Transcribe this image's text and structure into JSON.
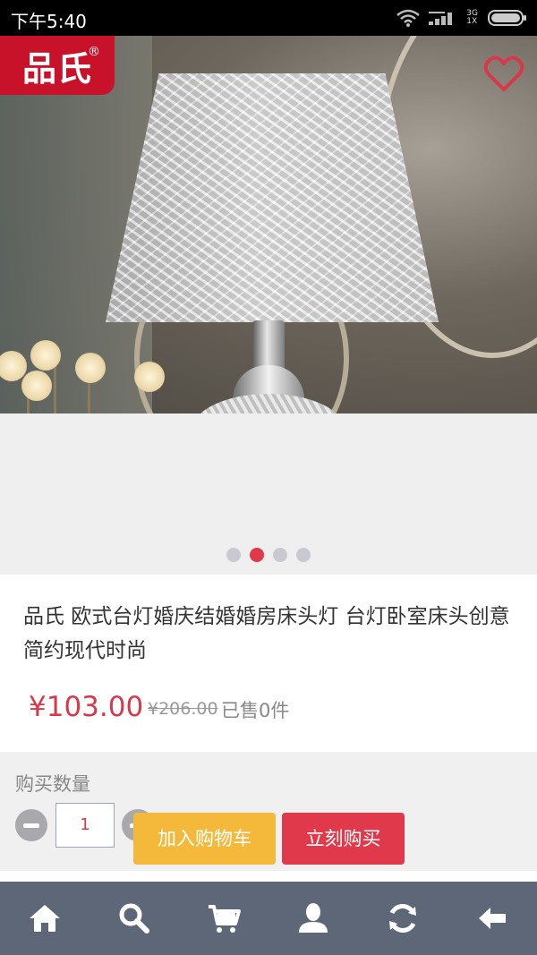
{
  "status_bar": {
    "time": "下午5:40",
    "network": "3G",
    "sim": "1X"
  },
  "brand": {
    "logo_text": "品氏",
    "logo_mark": "®",
    "color": "#c8122a"
  },
  "gallery": {
    "slide_count": 4,
    "active_index": 1
  },
  "product": {
    "title": "品氏 欧式台灯婚庆结婚婚房床头灯 台灯卧室床头创意简约现代时尚",
    "price": "¥103.00",
    "original_price": "¥206.00",
    "sold": "已售0件"
  },
  "purchase": {
    "quantity_label": "购买数量",
    "quantity": "1",
    "add_to_cart": "加入购物车",
    "buy_now": "立刻购买"
  },
  "bottom_nav": {
    "items": [
      "home-icon",
      "search-icon",
      "cart-icon",
      "user-icon",
      "refresh-icon",
      "back-arrow-icon"
    ]
  },
  "colors": {
    "accent": "#e0394b",
    "cart_button": "#f4b83a",
    "nav_bg": "#5d6777"
  }
}
